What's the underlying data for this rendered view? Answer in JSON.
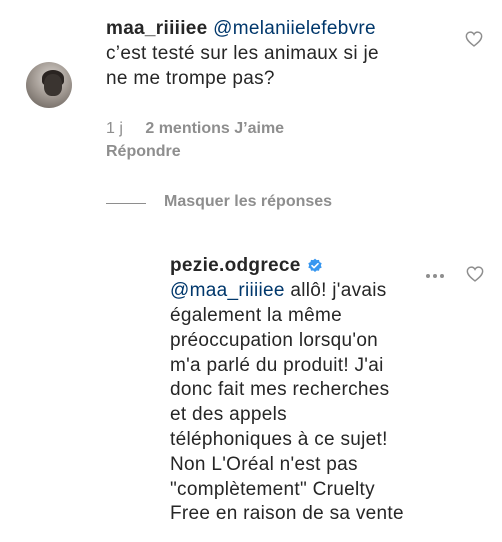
{
  "comment": {
    "username": "maa_riiiiee",
    "mention": "@melaniielefebvre",
    "text_line1": "c’est testé sur les animaux si je",
    "text_line2": "ne me trompe pas?",
    "time": "1 j",
    "likes": "2 mentions J’aime",
    "reply_label": "Répondre"
  },
  "replies_toggle": {
    "label": "Masquer les réponses"
  },
  "reply": {
    "username": "pezie.odgrece",
    "mention": "@maa_riiiiee",
    "line1_rest": " allô! j'avais",
    "lines": [
      "également la même",
      "préoccupation lorsqu'on",
      "m'a parlé du produit! J'ai",
      "donc fait mes recherches",
      "et des appels",
      "téléphoniques à ce sujet!",
      "Non L'Oréal n'est pas",
      "\"complètement\" Cruelty",
      "Free en raison de sa vente"
    ]
  },
  "icons": {
    "like": "heart-outline-icon",
    "verified": "verified-badge-icon",
    "more": "more-options-icon"
  },
  "colors": {
    "text": "#262626",
    "secondary": "#8e8e8e",
    "mention": "#00376b",
    "verified": "#3897f0"
  }
}
